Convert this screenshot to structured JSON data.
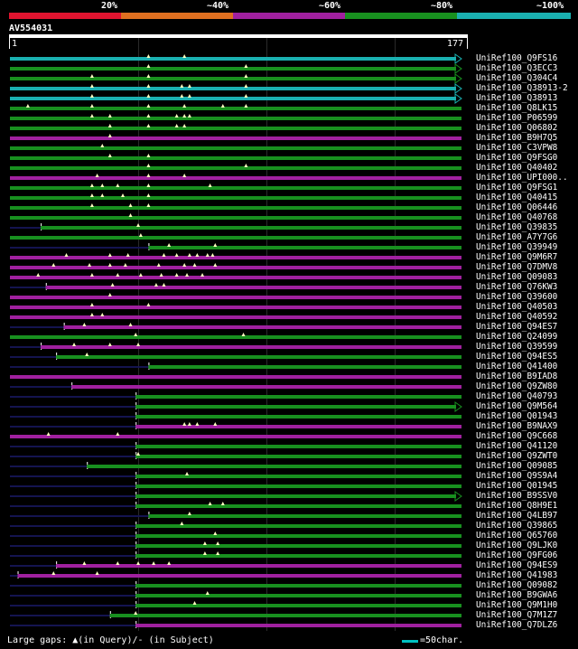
{
  "legend": {
    "labels": [
      "20%",
      "~40%",
      "~60%",
      "~80%",
      "~100%"
    ],
    "colors": [
      "#e0142f",
      "#e07020",
      "#a0209f",
      "#18901f",
      "#1ab0b0"
    ]
  },
  "query": {
    "name": "AV554031",
    "start": "1",
    "end": "177",
    "length": 177
  },
  "colors": {
    "teal": "#1ab0b0",
    "green": "#18901f",
    "purple": "#a0209f",
    "dark": "#141450",
    "triangle": "#ffffc0"
  },
  "hits": [
    {
      "name": "UniRef100_Q9FS16",
      "color": "teal",
      "start": 1,
      "end": 177,
      "arrow": true,
      "gaps": [
        55,
        69
      ]
    },
    {
      "name": "UniRef100_Q3ECC3",
      "color": "green",
      "start": 1,
      "end": 177,
      "arrow": true,
      "gaps": [
        55,
        93
      ]
    },
    {
      "name": "UniRef100_Q304C4",
      "color": "green",
      "start": 1,
      "end": 177,
      "arrow": true,
      "gaps": [
        33,
        55,
        93
      ]
    },
    {
      "name": "UniRef100_Q38913-2",
      "color": "teal",
      "start": 1,
      "end": 177,
      "arrow": true,
      "gaps": [
        33,
        55,
        68,
        71,
        93
      ]
    },
    {
      "name": "UniRef100_Q38913",
      "color": "teal",
      "start": 1,
      "end": 177,
      "arrow": true,
      "gaps": [
        33,
        55,
        68,
        71,
        93
      ]
    },
    {
      "name": "UniRef100_Q8LK15",
      "color": "green",
      "start": 1,
      "end": 177,
      "arrow": false,
      "gaps": [
        8,
        33,
        55,
        69,
        84,
        93
      ]
    },
    {
      "name": "UniRef100_P06599",
      "color": "green",
      "start": 1,
      "end": 177,
      "arrow": false,
      "gaps": [
        33,
        40,
        55,
        66,
        69,
        71
      ]
    },
    {
      "name": "UniRef100_Q06802",
      "color": "green",
      "start": 1,
      "end": 177,
      "arrow": false,
      "gaps": [
        40,
        55,
        66,
        69
      ]
    },
    {
      "name": "UniRef100_B9H7Q5",
      "color": "purple",
      "start": 1,
      "end": 177,
      "arrow": false,
      "gaps": [
        40
      ]
    },
    {
      "name": "UniRef100_C3VPW8",
      "color": "green",
      "start": 1,
      "end": 177,
      "arrow": false,
      "gaps": [
        37
      ]
    },
    {
      "name": "UniRef100_Q9FSG0",
      "color": "green",
      "start": 1,
      "end": 177,
      "arrow": false,
      "gaps": [
        40,
        55
      ]
    },
    {
      "name": "UniRef100_Q40402",
      "color": "green",
      "start": 1,
      "end": 177,
      "arrow": false,
      "gaps": [
        55,
        93
      ]
    },
    {
      "name": "UniRef100_UPI000..",
      "color": "purple",
      "start": 1,
      "end": 177,
      "arrow": false,
      "gaps": [
        35,
        55,
        69
      ]
    },
    {
      "name": "UniRef100_Q9FSG1",
      "color": "green",
      "start": 1,
      "end": 177,
      "arrow": false,
      "gaps": [
        33,
        37,
        43,
        55,
        79
      ]
    },
    {
      "name": "UniRef100_Q40415",
      "color": "green",
      "start": 1,
      "end": 177,
      "arrow": false,
      "gaps": [
        33,
        37,
        45,
        55
      ]
    },
    {
      "name": "UniRef100_Q06446",
      "color": "green",
      "start": 1,
      "end": 177,
      "arrow": false,
      "gaps": [
        33,
        48,
        55
      ]
    },
    {
      "name": "UniRef100_Q40768",
      "color": "green",
      "start": 1,
      "end": 177,
      "arrow": false,
      "gaps": [
        48
      ]
    },
    {
      "name": "UniRef100_Q39835",
      "color": "green",
      "start": 13,
      "end": 177,
      "arrow": false,
      "gaps": [
        51
      ]
    },
    {
      "name": "UniRef100_A7Y7G6",
      "color": "green",
      "start": 1,
      "end": 177,
      "arrow": false,
      "gaps": [
        52
      ]
    },
    {
      "name": "UniRef100_Q39949",
      "color": "green",
      "start": 55,
      "end": 177,
      "arrow": false,
      "gaps": [
        63,
        81
      ]
    },
    {
      "name": "UniRef100_Q9M6R7",
      "color": "purple",
      "start": 1,
      "end": 177,
      "arrow": false,
      "gaps": [
        23,
        40,
        47,
        61,
        66,
        71,
        74,
        78,
        80
      ]
    },
    {
      "name": "UniRef100_Q7DMV8",
      "color": "purple",
      "start": 1,
      "end": 177,
      "arrow": false,
      "gaps": [
        18,
        32,
        40,
        46,
        59,
        69,
        73,
        81
      ]
    },
    {
      "name": "UniRef100_Q09083",
      "color": "purple",
      "start": 1,
      "end": 177,
      "arrow": false,
      "gaps": [
        12,
        33,
        43,
        52,
        60,
        66,
        70,
        76
      ]
    },
    {
      "name": "UniRef100_Q76KW3",
      "color": "purple",
      "start": 15,
      "end": 177,
      "arrow": false,
      "gaps": [
        41,
        58,
        61
      ]
    },
    {
      "name": "UniRef100_Q39600",
      "color": "purple",
      "start": 1,
      "end": 177,
      "arrow": false,
      "gaps": [
        40
      ]
    },
    {
      "name": "UniRef100_Q40503",
      "color": "purple",
      "start": 1,
      "end": 177,
      "arrow": false,
      "gaps": [
        33,
        55
      ]
    },
    {
      "name": "UniRef100_Q40592",
      "color": "purple",
      "start": 1,
      "end": 177,
      "arrow": false,
      "gaps": [
        33,
        37
      ]
    },
    {
      "name": "UniRef100_Q94ES7",
      "color": "purple",
      "start": 22,
      "end": 177,
      "arrow": false,
      "gaps": [
        30,
        48
      ]
    },
    {
      "name": "UniRef100_Q24099",
      "color": "green",
      "start": 1,
      "end": 177,
      "arrow": false,
      "gaps": [
        50,
        92
      ]
    },
    {
      "name": "UniRef100_Q39599",
      "color": "purple",
      "start": 13,
      "end": 177,
      "arrow": false,
      "gaps": [
        26,
        40,
        51
      ]
    },
    {
      "name": "UniRef100_Q94ES5",
      "color": "green",
      "start": 19,
      "end": 177,
      "arrow": false,
      "gaps": [
        31
      ]
    },
    {
      "name": "UniRef100_Q41400",
      "color": "green",
      "start": 55,
      "end": 177,
      "arrow": false,
      "gaps": []
    },
    {
      "name": "UniRef100_B9IAD8",
      "color": "purple",
      "start": 1,
      "end": 177,
      "arrow": false,
      "gaps": []
    },
    {
      "name": "UniRef100_Q9ZW80",
      "color": "purple",
      "start": 25,
      "end": 177,
      "arrow": false,
      "gaps": []
    },
    {
      "name": "UniRef100_Q40793",
      "color": "green",
      "start": 50,
      "end": 177,
      "arrow": false,
      "gaps": []
    },
    {
      "name": "UniRef100_Q9M564",
      "color": "green",
      "start": 50,
      "end": 177,
      "arrow": true,
      "gaps": []
    },
    {
      "name": "UniRef100_Q01943",
      "color": "green",
      "start": 50,
      "end": 177,
      "arrow": false,
      "gaps": []
    },
    {
      "name": "UniRef100_B9NAX9",
      "color": "purple",
      "start": 50,
      "end": 177,
      "arrow": false,
      "gaps": [
        69,
        71,
        74,
        81
      ]
    },
    {
      "name": "UniRef100_Q9C668",
      "color": "purple",
      "start": 1,
      "end": 177,
      "arrow": false,
      "gaps": [
        16,
        43
      ]
    },
    {
      "name": "UniRef100_Q41120",
      "color": "green",
      "start": 50,
      "end": 177,
      "arrow": false,
      "gaps": []
    },
    {
      "name": "UniRef100_Q9ZWT0",
      "color": "green",
      "start": 50,
      "end": 177,
      "arrow": false,
      "gaps": [
        51
      ]
    },
    {
      "name": "UniRef100_Q09085",
      "color": "green",
      "start": 31,
      "end": 177,
      "arrow": false,
      "gaps": []
    },
    {
      "name": "UniRef100_Q9S9A4",
      "color": "green",
      "start": 50,
      "end": 177,
      "arrow": false,
      "gaps": [
        70
      ]
    },
    {
      "name": "UniRef100_Q01945",
      "color": "green",
      "start": 50,
      "end": 177,
      "arrow": false,
      "gaps": []
    },
    {
      "name": "UniRef100_B9SSV0",
      "color": "green",
      "start": 50,
      "end": 177,
      "arrow": true,
      "gaps": []
    },
    {
      "name": "UniRef100_Q8H9E1",
      "color": "green",
      "start": 50,
      "end": 177,
      "arrow": false,
      "gaps": [
        79,
        84
      ]
    },
    {
      "name": "UniRef100_Q4LB97",
      "color": "green",
      "start": 55,
      "end": 177,
      "arrow": false,
      "gaps": [
        71
      ]
    },
    {
      "name": "UniRef100_Q39865",
      "color": "green",
      "start": 50,
      "end": 177,
      "arrow": false,
      "gaps": [
        68
      ]
    },
    {
      "name": "UniRef100_Q65760",
      "color": "green",
      "start": 50,
      "end": 177,
      "arrow": false,
      "gaps": [
        81
      ]
    },
    {
      "name": "UniRef100_Q9LJK0",
      "color": "green",
      "start": 50,
      "end": 177,
      "arrow": false,
      "gaps": [
        77,
        82
      ]
    },
    {
      "name": "UniRef100_Q9FG06",
      "color": "green",
      "start": 50,
      "end": 177,
      "arrow": false,
      "gaps": [
        77,
        82
      ]
    },
    {
      "name": "UniRef100_Q94ES9",
      "color": "purple",
      "start": 19,
      "end": 177,
      "arrow": false,
      "gaps": [
        30,
        43,
        51,
        57,
        63
      ]
    },
    {
      "name": "UniRef100_Q41983",
      "color": "purple",
      "start": 4,
      "end": 177,
      "arrow": false,
      "gaps": [
        18,
        35
      ]
    },
    {
      "name": "UniRef100_Q09082",
      "color": "green",
      "start": 50,
      "end": 177,
      "arrow": false,
      "gaps": []
    },
    {
      "name": "UniRef100_B9GWA6",
      "color": "green",
      "start": 50,
      "end": 177,
      "arrow": false,
      "gaps": [
        78
      ]
    },
    {
      "name": "UniRef100_Q9M1H0",
      "color": "green",
      "start": 50,
      "end": 177,
      "arrow": false,
      "gaps": [
        73
      ]
    },
    {
      "name": "UniRef100_Q7M1Z7",
      "color": "green",
      "start": 40,
      "end": 177,
      "arrow": false,
      "gaps": [
        50
      ]
    },
    {
      "name": "UniRef100_Q7DLZ6",
      "color": "purple",
      "start": 50,
      "end": 177,
      "arrow": false,
      "gaps": []
    }
  ],
  "footer": {
    "gap_text": "Large gaps: ▲(in Query)/- (in Subject)",
    "scale_text": "=50char."
  }
}
